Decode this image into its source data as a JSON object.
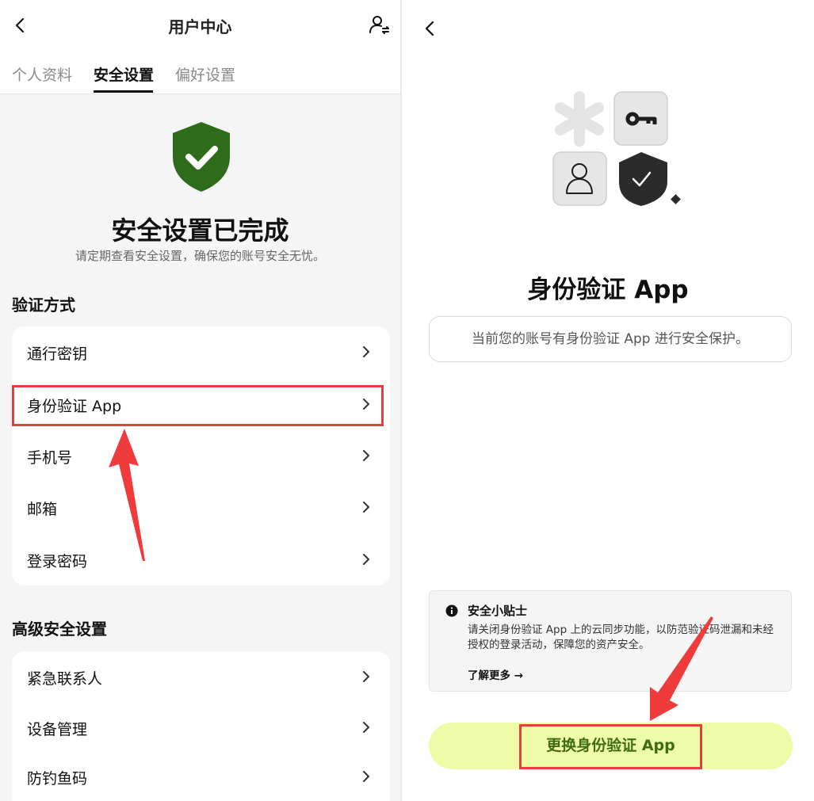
{
  "left": {
    "header": {
      "title": "用户中心"
    },
    "tabs": [
      {
        "label": "个人资料"
      },
      {
        "label": "安全设置"
      },
      {
        "label": "偏好设置"
      }
    ],
    "status": {
      "title": "安全设置已完成",
      "subtitle": "请定期查看安全设置，确保您的账号安全无忧。"
    },
    "verification": {
      "section_title": "验证方式",
      "items": [
        {
          "label": "通行密钥"
        },
        {
          "label": "身份验证 App"
        },
        {
          "label": "手机号"
        },
        {
          "label": "邮箱"
        },
        {
          "label": "登录密码"
        }
      ]
    },
    "advanced": {
      "section_title": "高级安全设置",
      "items": [
        {
          "label": "紧急联系人"
        },
        {
          "label": "设备管理"
        },
        {
          "label": "防钓鱼码"
        }
      ]
    }
  },
  "right": {
    "title": "身份验证 App",
    "info_text": "当前您的账号有身份验证 App 进行安全保护。",
    "tips": {
      "title": "安全小贴士",
      "body": "请关闭身份验证 App 上的云同步功能，以防范验证码泄漏和未经授权的登录活动，保障您的资产安全。",
      "link": "了解更多 →"
    },
    "primary_button": "更换身份验证 App"
  },
  "colors": {
    "shield_green": "#2e6b1b",
    "button_bg": "#eefca8",
    "button_text": "#3f6b12",
    "annotation_red": "#e53e3e"
  },
  "icons": [
    "back-icon",
    "user-switch-icon",
    "shield-check-icon",
    "chevron-right-icon",
    "asterisk-icon",
    "key-icon",
    "person-icon",
    "info-icon"
  ]
}
